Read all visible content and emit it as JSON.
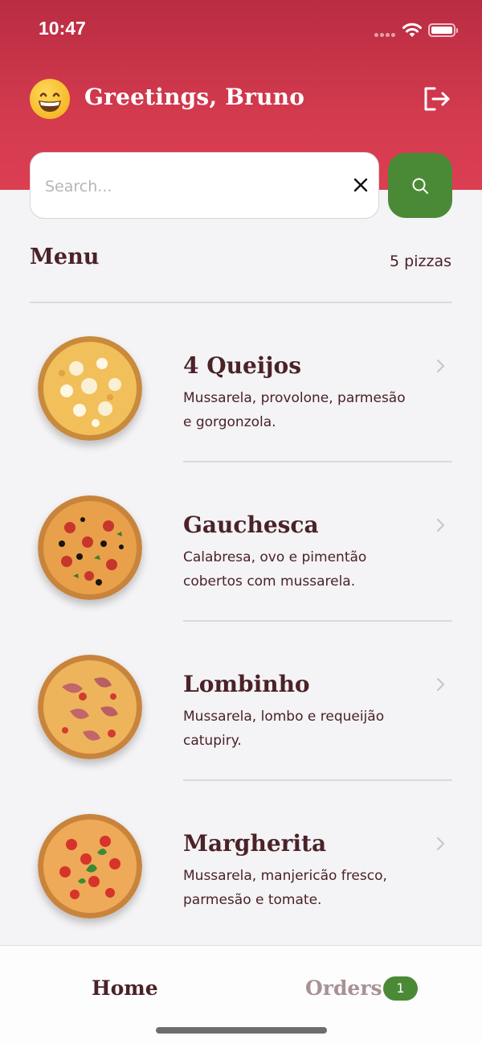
{
  "status_bar": {
    "time": "10:47"
  },
  "header": {
    "greeting": "Greetings, Bruno",
    "emoji_icon": "grinning-face-icon",
    "logout_icon": "logout-icon"
  },
  "search": {
    "placeholder": "Search...",
    "value": ""
  },
  "menu": {
    "title": "Menu",
    "count": "5 pizzas",
    "items": [
      {
        "name": "4 Queijos",
        "description": "Mussarela, provolone, parmesão e gorgonzola."
      },
      {
        "name": "Gauchesca",
        "description": "Calabresa, ovo e pimentão cobertos com mussarela."
      },
      {
        "name": "Lombinho",
        "description": "Mussarela, lombo e requeijão catupiry."
      },
      {
        "name": "Margherita",
        "description": "Mussarela, manjericão fresco, parmesão e tomate."
      }
    ]
  },
  "tabbar": {
    "home": "Home",
    "orders": "Orders",
    "orders_badge": "1"
  },
  "colors": {
    "header_red": "#d33a4e",
    "accent_green": "#4a8a37",
    "text_dark": "#4a2228"
  }
}
